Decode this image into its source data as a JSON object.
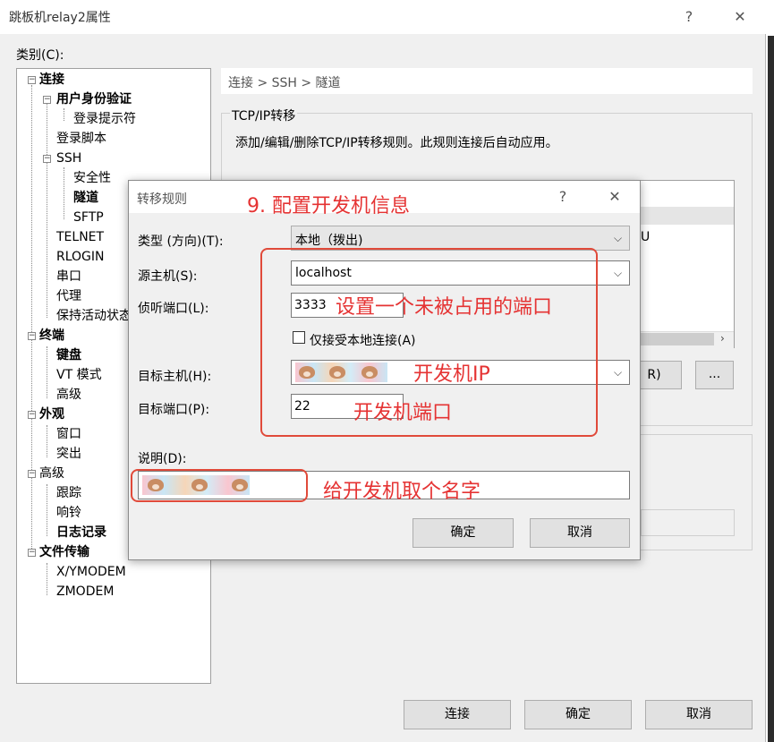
{
  "main_window": {
    "title": "跳板机relay2属性",
    "help_glyph": "?",
    "close_glyph": "✕",
    "category_label": "类别(C):",
    "tree": [
      {
        "label": "连接",
        "bold": true
      },
      {
        "label": "用户身份验证",
        "bold": true
      },
      {
        "label": "登录提示符",
        "bold": false
      },
      {
        "label": "登录脚本",
        "bold": false
      },
      {
        "label": "SSH",
        "bold": false
      },
      {
        "label": "安全性",
        "bold": false
      },
      {
        "label": "隧道",
        "bold": true
      },
      {
        "label": "SFTP",
        "bold": false
      },
      {
        "label": "TELNET",
        "bold": false
      },
      {
        "label": "RLOGIN",
        "bold": false
      },
      {
        "label": "串口",
        "bold": false
      },
      {
        "label": "代理",
        "bold": false
      },
      {
        "label": "保持活动状态",
        "bold": false
      },
      {
        "label": "终端",
        "bold": true
      },
      {
        "label": "键盘",
        "bold": true
      },
      {
        "label": "VT 模式",
        "bold": false
      },
      {
        "label": "高级",
        "bold": false
      },
      {
        "label": "外观",
        "bold": true
      },
      {
        "label": "窗口",
        "bold": false
      },
      {
        "label": "突出",
        "bold": false
      },
      {
        "label": "高级",
        "bold": false
      },
      {
        "label": "跟踪",
        "bold": false
      },
      {
        "label": "响铃",
        "bold": false
      },
      {
        "label": "日志记录",
        "bold": true
      },
      {
        "label": "文件传输",
        "bold": true
      },
      {
        "label": "X/YMODEM",
        "bold": false
      },
      {
        "label": "ZMODEM",
        "bold": false
      }
    ],
    "breadcrumb": "连接 > SSH > 隧道",
    "group_title": "TCP/IP转移",
    "group_description": "添加/编辑/删除TCP/IP转移规则。此规则连接后自动应用。",
    "list_partial_text": "U",
    "partial_button_label": "R)",
    "ellipsis_button": "...",
    "buttons": {
      "connect": "连接",
      "ok": "确定",
      "cancel": "取消"
    }
  },
  "dialog": {
    "title": "转移规则",
    "help_glyph": "?",
    "close_glyph": "✕",
    "type_label": "类型 (方向)(T):",
    "type_value": "本地（拨出)",
    "source_host_label": "源主机(S):",
    "source_host_value": "localhost",
    "listen_port_label": "侦听端口(L):",
    "listen_port_value": "3333",
    "local_only_label": "仅接受本地连接(A)",
    "local_only_checked": false,
    "target_host_label": "目标主机(H):",
    "target_port_label": "目标端口(P):",
    "target_port_value": "22",
    "description_label": "说明(D):",
    "ok_button": "确定",
    "cancel_button": "取消"
  },
  "annotations": {
    "step_title": "9. 配置开发机信息",
    "port_hint": "设置一个未被占用的端口",
    "host_hint": "开发机IP",
    "port_target_hint": "开发机端口",
    "name_hint": "给开发机取个名字",
    "color": "#e53333"
  }
}
